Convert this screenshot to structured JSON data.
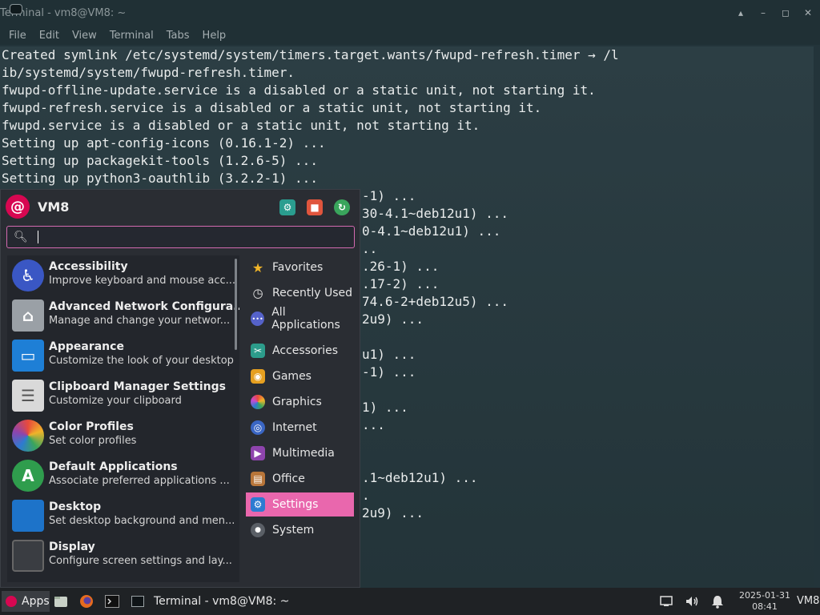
{
  "window": {
    "title": "Terminal - vm8@VM8: ~",
    "controls": {
      "shade": "▴",
      "minimize": "–",
      "maximize": "◻",
      "close": "✕"
    }
  },
  "menubar": [
    "File",
    "Edit",
    "View",
    "Terminal",
    "Tabs",
    "Help"
  ],
  "terminal": {
    "lines": [
      "Created symlink /etc/systemd/system/timers.target.wants/fwupd-refresh.timer → /l",
      "ib/systemd/system/fwupd-refresh.timer.",
      "fwupd-offline-update.service is a disabled or a static unit, not starting it.",
      "fwupd-refresh.service is a disabled or a static unit, not starting it.",
      "fwupd.service is a disabled or a static unit, not starting it.",
      "Setting up apt-config-icons (0.16.1-2) ...",
      "Setting up packagekit-tools (1.2.6-5) ...",
      "Setting up python3-oauthlib (3.2.2-1) ..."
    ],
    "fragments": [
      "-1) ...",
      "30-4.1~deb12u1) ...",
      "0-4.1~deb12u1) ...",
      "..",
      ".26-1) ...",
      ".17-2) ...",
      "74.6-2+deb12u5) ...",
      "2u9) ...",
      "",
      "u1) ...",
      "-1) ...",
      "",
      "1) ...",
      "...",
      "",
      "",
      ".1~deb12u1) ...",
      ".",
      "2u9) ..."
    ]
  },
  "menu": {
    "user": "VM8",
    "search": {
      "value": "",
      "placeholder": ""
    },
    "header_icons": [
      "settings-manager-icon",
      "lock-screen-icon",
      "log-out-icon"
    ],
    "apps": [
      {
        "name": "Accessibility",
        "desc": "Improve keyboard and mouse acc...",
        "icon": "accessibility-icon",
        "color": "#3a57c4",
        "glyph": "♿"
      },
      {
        "name": "Advanced Network Configura...",
        "desc": "Manage and change your networ...",
        "icon": "network-icon",
        "color": "#9aa0a6",
        "glyph": "⌂"
      },
      {
        "name": "Appearance",
        "desc": "Customize the look of your desktop",
        "icon": "appearance-icon",
        "color": "#1e7fd6",
        "glyph": "▭"
      },
      {
        "name": "Clipboard Manager Settings",
        "desc": "Customize your clipboard",
        "icon": "clipboard-icon",
        "color": "#d9d9d9",
        "glyph": "☰"
      },
      {
        "name": "Color Profiles",
        "desc": "Set color profiles",
        "icon": "color-profiles-icon",
        "color": "#e84a8c",
        "glyph": "✿"
      },
      {
        "name": "Default Applications",
        "desc": "Associate preferred applications ...",
        "icon": "default-apps-icon",
        "color": "#2f9d4d",
        "glyph": "A"
      },
      {
        "name": "Desktop",
        "desc": "Set desktop background and men...",
        "icon": "desktop-icon",
        "color": "#1d73c9",
        "glyph": ""
      },
      {
        "name": "Display",
        "desc": "Configure screen settings and lay...",
        "icon": "display-icon",
        "color": "#3a3d42",
        "glyph": ""
      }
    ],
    "categories": [
      {
        "label": "Favorites",
        "icon": "star-icon",
        "color": "#f0b429",
        "glyph": "★"
      },
      {
        "label": "Recently Used",
        "icon": "clock-icon",
        "color": "#3b4048",
        "glyph": "◷"
      },
      {
        "label": "All Applications",
        "icon": "all-apps-icon",
        "color": "#5562c9",
        "glyph": "•••"
      },
      {
        "label": "Accessories",
        "icon": "accessories-icon",
        "color": "#2c9c8b",
        "glyph": "✂"
      },
      {
        "label": "Games",
        "icon": "games-icon",
        "color": "#e6a020",
        "glyph": "◉"
      },
      {
        "label": "Graphics",
        "icon": "graphics-icon",
        "color": "#c94ad0",
        "glyph": "◈"
      },
      {
        "label": "Internet",
        "icon": "internet-icon",
        "color": "#3a66c4",
        "glyph": "◎"
      },
      {
        "label": "Multimedia",
        "icon": "multimedia-icon",
        "color": "#8e44ad",
        "glyph": "▶"
      },
      {
        "label": "Office",
        "icon": "office-icon",
        "color": "#b8763a",
        "glyph": "▤"
      },
      {
        "label": "Settings",
        "icon": "settings-icon",
        "color": "#2d7bd1",
        "glyph": "⚙",
        "active": true
      },
      {
        "label": "System",
        "icon": "system-icon",
        "color": "#5a5f66",
        "glyph": "●"
      }
    ]
  },
  "taskbar": {
    "apps_label": "Apps",
    "task_title": "Terminal - vm8@VM8: ~",
    "date": "2025-01-31",
    "time": "08:41",
    "host": "VM8",
    "launchers": [
      "file-manager-icon",
      "firefox-icon",
      "terminal-icon"
    ],
    "tray": [
      "network-icon",
      "volume-icon",
      "notifications-icon"
    ]
  }
}
